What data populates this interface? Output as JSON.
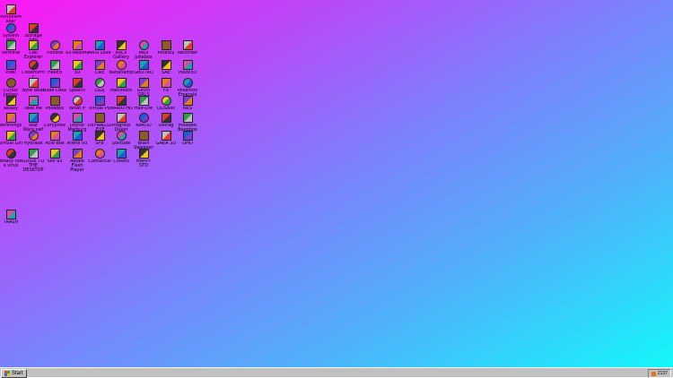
{
  "desktop": {
    "icons": [
      {
        "label": "WindowMaker"
      },
      {
        "label": "System Info"
      },
      {
        "label": "Storage Info"
      },
      {
        "label": "Terminal"
      },
      {
        "label": "Ciel Explorer"
      },
      {
        "label": "Trollbox"
      },
      {
        "label": "93 Realms"
      },
      {
        "label": "ANSI Love"
      },
      {
        "label": "ASCII Gallery"
      },
      {
        "label": "MIDI Jukebox"
      },
      {
        "label": "Potatoy"
      },
      {
        "label": "Recorder"
      },
      {
        "label": "Pixel"
      },
      {
        "label": "Codemirror"
      },
      {
        "label": "HexEd"
      },
      {
        "label": "3D"
      },
      {
        "label": "Calc"
      },
      {
        "label": "Bananamp"
      },
      {
        "label": "GBOTRO"
      },
      {
        "label": "SAE"
      },
      {
        "label": "Maze3D"
      },
      {
        "label": "Cursor Jockey"
      },
      {
        "label": "Byte Beat"
      },
      {
        "label": "Bible Data"
      },
      {
        "label": "Speech"
      },
      {
        "label": "LSDJ"
      },
      {
        "label": "Manifesto"
      },
      {
        "label": "Glitch GRLS"
      },
      {
        "label": "FX"
      },
      {
        "label": "Pokemon Emerald"
      },
      {
        "label": "Robby"
      },
      {
        "label": "Take Me"
      },
      {
        "label": "Pokédex"
      },
      {
        "label": "What If"
      },
      {
        "label": "Virtual PC"
      },
      {
        "label": "MARIO HD"
      },
      {
        "label": "Half-Life"
      },
      {
        "label": "DOSBox"
      },
      {
        "label": "NES"
      },
      {
        "label": "lemmings"
      },
      {
        "label": "Star Wars.swf"
      },
      {
        "label": "Coryphee"
      },
      {
        "label": "Doctor Marburg"
      },
      {
        "label": "DEFRAG32.EXE"
      },
      {
        "label": "Progress Quest"
      },
      {
        "label": "KeROD"
      },
      {
        "label": "Defrag"
      },
      {
        "label": "Modded Beepbox"
      },
      {
        "label": "Virtual Girl"
      },
      {
        "label": "Hydraxe"
      },
      {
        "label": "Acid Box"
      },
      {
        "label": "Arena 93"
      },
      {
        "label": "SFB"
      },
      {
        "label": "Solitude"
      },
      {
        "label": "Brain Sweeper"
      },
      {
        "label": "GAEA 3D"
      },
      {
        "label": "DHO"
      },
      {
        "label": "Totally not a virus"
      },
      {
        "label": "GUIDE TO THE DESKTOP"
      },
      {
        "label": "SIM 93"
      },
      {
        "label": "Adobe Flash Player"
      },
      {
        "label": "Contactus"
      },
      {
        "label": "Credits"
      },
      {
        "label": "HAPPY STD"
      },
      {
        "label": "TRASH"
      }
    ]
  },
  "taskbar": {
    "start_label": "Start",
    "clock": "2137"
  },
  "colors": {
    "gradient_start": "#ff17f5",
    "gradient_end": "#13f7fa",
    "taskbar": "#c0c0c0"
  }
}
